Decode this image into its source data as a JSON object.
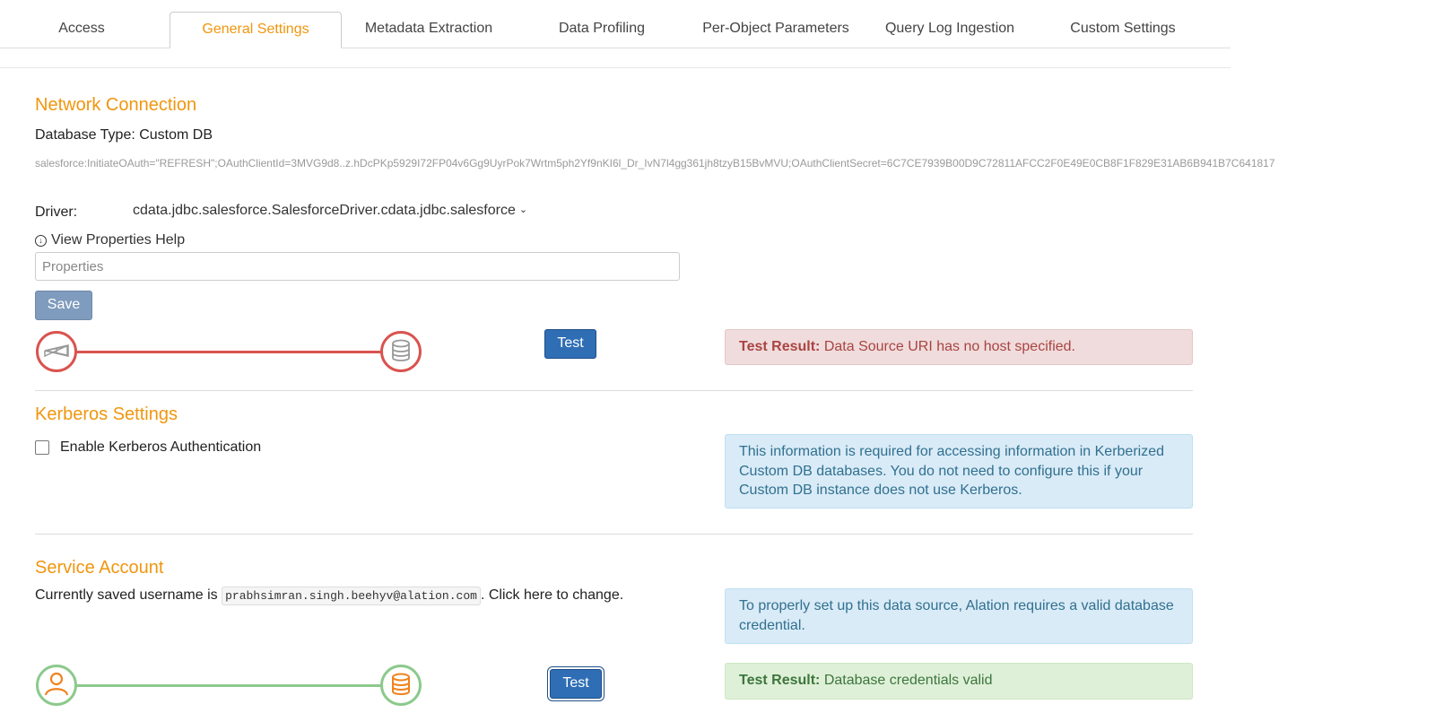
{
  "tabs": [
    {
      "label": "Access"
    },
    {
      "label": "General Settings"
    },
    {
      "label": "Metadata Extraction"
    },
    {
      "label": "Data Profiling"
    },
    {
      "label": "Per-Object Parameters"
    },
    {
      "label": "Query Log Ingestion"
    },
    {
      "label": "Custom Settings"
    }
  ],
  "active_tab": "General Settings",
  "network": {
    "heading": "Network Connection",
    "db_type": "Database Type: Custom DB",
    "uri": "salesforce:InitiateOAuth=\"REFRESH\";OAuthClientId=3MVG9d8..z.hDcPKp5929I72FP04v6Gg9UyrPok7Wrtm5ph2Yf9nKI6l_Dr_IvN7l4gg361jh8tzyB15BvMVU;OAuthClientSecret=6C7CE7939B00D9C72811AFCC2F0E49E0CB8F1F829E31AB6B941B7C641817",
    "driver_label": "Driver:",
    "driver_value": "cdata.jdbc.salesforce.SalesforceDriver.cdata.jdbc.salesforce",
    "help_label": "View Properties Help",
    "properties_placeholder": "Properties",
    "save_label": "Save",
    "test_label": "Test",
    "result_label": "Test Result:",
    "result_text": " Data Source URI has no host specified."
  },
  "kerberos": {
    "heading": "Kerberos Settings",
    "checkbox_label": "Enable Kerberos Authentication",
    "checked": false,
    "info": "This information is required for accessing information in Kerberized Custom DB databases. You do not need to configure this if your Custom DB instance does not use Kerberos."
  },
  "service": {
    "heading": "Service Account",
    "prefix": "Currently saved username is ",
    "username": "prabhsimran.singh.beehyv@alation.com",
    "mid": ". ",
    "link": "Click here",
    "suffix": " to change.",
    "info": "To properly set up this data source, Alation requires a valid database credential.",
    "test_label": "Test",
    "result_label": "Test Result:",
    "result_text": " Database credentials valid"
  },
  "colors": {
    "accent": "#f0960e",
    "error": "#d9534f",
    "success": "#8cc98c",
    "icon_orange": "#f0821e"
  },
  "icons": [
    "connection-icon",
    "database-icon",
    "user-icon",
    "info-circle-icon",
    "chevron-down-icon"
  ]
}
